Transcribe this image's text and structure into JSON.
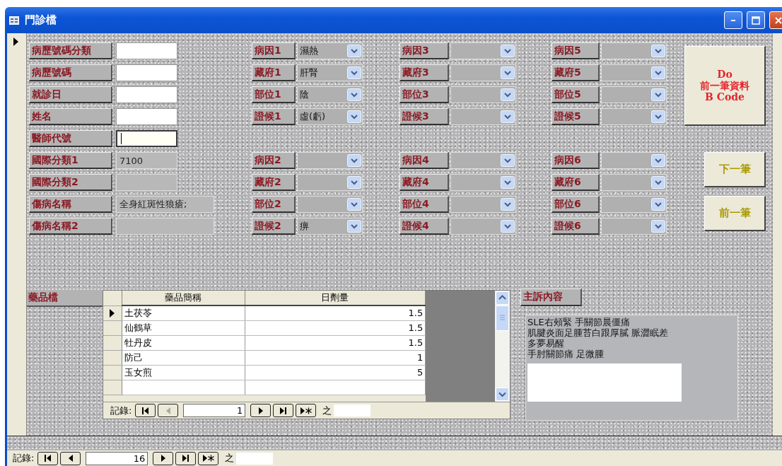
{
  "window": {
    "title": "門診檔"
  },
  "fields": [
    {
      "label": "病歷號碼分類",
      "kind": "entry",
      "focused": false
    },
    {
      "label": "病歷號碼",
      "kind": "entry",
      "focused": false
    },
    {
      "label": "就診日",
      "kind": "entry",
      "focused": false
    },
    {
      "label": "姓名",
      "kind": "entry",
      "focused": false
    },
    {
      "label": "醫師代號",
      "kind": "entry",
      "focused": true
    },
    {
      "label": "國際分類1",
      "value": "7100",
      "kind": "readonly",
      "focused": false
    },
    {
      "label": "國際分類2",
      "kind": "readonly",
      "focused": false
    },
    {
      "label": "傷病名稱",
      "value": "全身紅斑性狼瘡;",
      "kind": "wide",
      "focused": false
    },
    {
      "label": "傷病名稱2",
      "kind": "wide",
      "focused": false
    }
  ],
  "diagnosis_groups": [
    {
      "fields": [
        {
          "label": "病因1",
          "value": "濕熱"
        },
        {
          "label": "藏府1",
          "value": "肝腎"
        },
        {
          "label": "部位1",
          "value": "陰"
        },
        {
          "label": "證候1",
          "value": "虛(虧)"
        }
      ]
    },
    {
      "fields": [
        {
          "label": "病因2"
        },
        {
          "label": "藏府2"
        },
        {
          "label": "部位2"
        },
        {
          "label": "證候2",
          "value": "痹"
        }
      ]
    },
    {
      "fields": [
        {
          "label": "病因3"
        },
        {
          "label": "藏府3"
        },
        {
          "label": "部位3"
        },
        {
          "label": "證候3"
        }
      ]
    },
    {
      "fields": [
        {
          "label": "病因4"
        },
        {
          "label": "藏府4"
        },
        {
          "label": "部位4"
        },
        {
          "label": "證候4"
        }
      ]
    },
    {
      "fields": [
        {
          "label": "病因5"
        },
        {
          "label": "藏府5"
        },
        {
          "label": "部位5"
        },
        {
          "label": "證候5"
        }
      ]
    },
    {
      "fields": [
        {
          "label": "病因6"
        },
        {
          "label": "藏府6"
        },
        {
          "label": "部位6"
        },
        {
          "label": "證候6"
        }
      ]
    }
  ],
  "actions": [
    {
      "kind": "primary",
      "lines": [
        "Do",
        "前一筆資料",
        "B Code"
      ]
    },
    {
      "kind": "nav",
      "lines": [
        "下一筆"
      ]
    },
    {
      "kind": "nav",
      "lines": [
        "前一筆"
      ]
    }
  ],
  "subform": {
    "label": "藥品檔",
    "columns": [
      "藥品簡稱",
      "日劑量"
    ],
    "rows": [
      {
        "cells": [
          "土茯苓",
          "1.5"
        ],
        "selected": true
      },
      {
        "cells": [
          "仙鶴草",
          "1.5"
        ],
        "selected": false
      },
      {
        "cells": [
          "牡丹皮",
          "1.5"
        ],
        "selected": false
      },
      {
        "cells": [
          "防己",
          "1"
        ],
        "selected": false
      },
      {
        "cells": [
          "玉女煎",
          "5"
        ],
        "selected": false
      }
    ],
    "navigation": {
      "label": "記錄:",
      "current": "1",
      "of_label": "之",
      "buttons": [
        {
          "kind": "first",
          "disabled": false
        },
        {
          "kind": "prev",
          "disabled": true
        },
        {
          "kind": "next",
          "disabled": false
        },
        {
          "kind": "last",
          "disabled": false
        },
        {
          "kind": "new",
          "disabled": false
        }
      ]
    }
  },
  "chief_complaint": {
    "label": "主訴內容",
    "lines": [
      "SLE右頰緊 手關節晨僵痛",
      "肌腱炎面足腫苔白跟厚膩 脈澀眠差",
      "多夢易醒",
      "手肘關節痛 足微腫"
    ]
  },
  "navigation": {
    "label": "記錄:",
    "current": "16",
    "of_label": "之",
    "buttons": [
      {
        "kind": "first",
        "disabled": false
      },
      {
        "kind": "prev",
        "disabled": false
      },
      {
        "kind": "next",
        "disabled": false
      },
      {
        "kind": "last",
        "disabled": false
      },
      {
        "kind": "new",
        "disabled": false
      }
    ]
  }
}
